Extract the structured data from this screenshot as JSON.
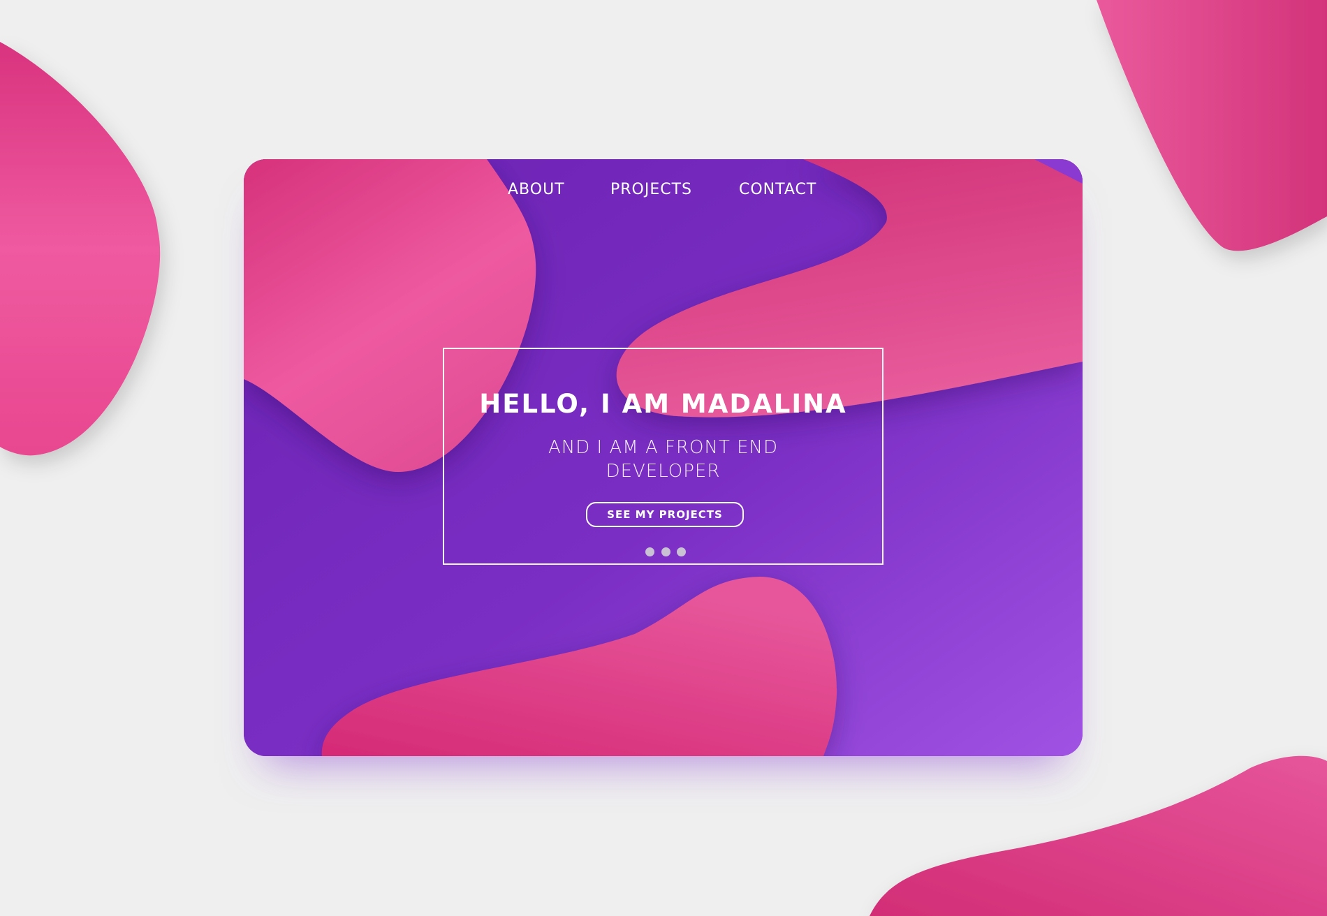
{
  "nav": {
    "items": [
      {
        "label": "ABOUT"
      },
      {
        "label": "PROJECTS"
      },
      {
        "label": "CONTACT"
      }
    ]
  },
  "hero": {
    "title": "HELLO, I AM MADALINA",
    "subtitle": "AND I AM A FRONT END DEVELOPER",
    "button_label": "SEE MY PROJECTS",
    "carousel_dots": 3
  },
  "colors": {
    "page_background": "#efefef",
    "purple": "#7a2fc6",
    "pink": "#e2478f",
    "white": "#ffffff"
  }
}
